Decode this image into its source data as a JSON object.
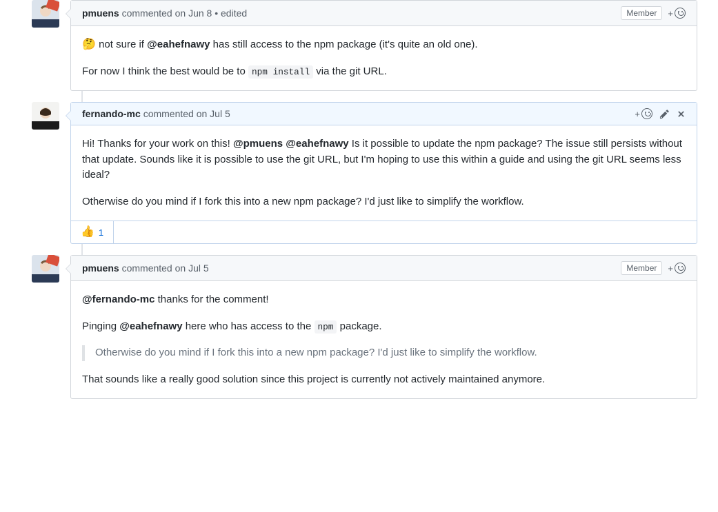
{
  "badges": {
    "member": "Member"
  },
  "comments": [
    {
      "author": "pmuens",
      "meta": "commented on Jun 8",
      "edited": "edited",
      "badge": "Member",
      "body": {
        "line1_pre": "not sure if ",
        "line1_mention": "@eahefnawy",
        "line1_post": " has still access to the npm package (it's quite an old one).",
        "line2_pre": "For now I think the best would be to ",
        "line2_code": "npm install",
        "line2_post": " via the git URL."
      }
    },
    {
      "author": "fernando-mc",
      "meta": "commented on Jul 5",
      "body": {
        "p1_a": "Hi! Thanks for your work on this! ",
        "p1_m1": "@pmuens",
        "p1_b": " ",
        "p1_m2": "@eahefnawy",
        "p1_c": " Is it possible to update the npm package? The issue still persists without that update. Sounds like it is possible to use the git URL, but I'm hoping to use this within a guide and using the git URL seems less ideal?",
        "p2": "Otherwise do you mind if I fork this into a new npm package? I'd just like to simplify the workflow."
      },
      "reactions": {
        "thumbs_up": 1
      }
    },
    {
      "author": "pmuens",
      "meta": "commented on Jul 5",
      "badge": "Member",
      "body": {
        "p1_m": "@fernando-mc",
        "p1_post": " thanks for the comment!",
        "p2_pre": "Pinging ",
        "p2_m": "@eahefnawy",
        "p2_mid": " here who has access to the ",
        "p2_code": "npm",
        "p2_post": " package.",
        "quote": "Otherwise do you mind if I fork this into a new npm package? I'd just like to simplify the workflow.",
        "p3": "That sounds like a really good solution since this project is currently not actively maintained anymore."
      }
    }
  ]
}
